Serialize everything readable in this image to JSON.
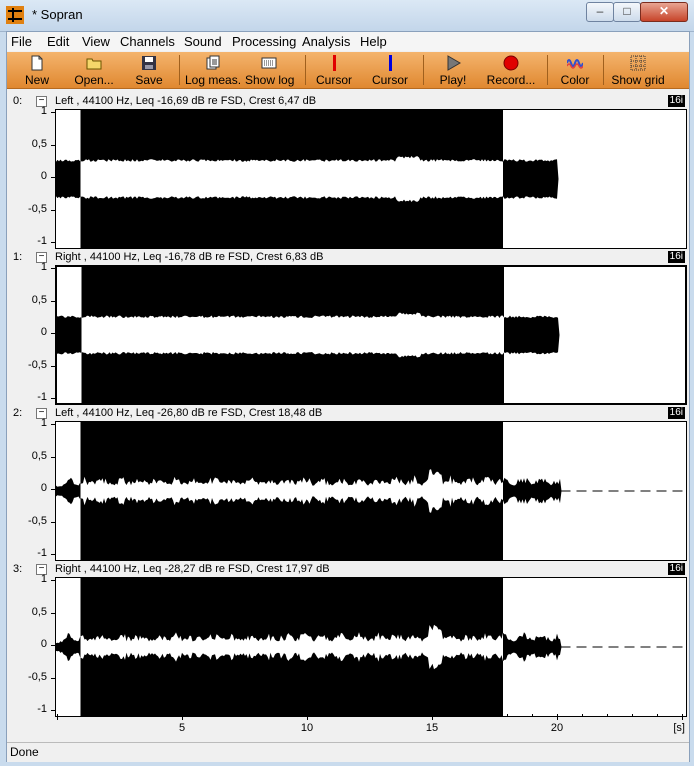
{
  "window": {
    "title": "* Sopran",
    "minimize": "–",
    "maximize": "□",
    "close": "✕"
  },
  "menu": [
    "File",
    "Edit",
    "View",
    "Channels",
    "Sound",
    "Processing",
    "Analysis",
    "Help"
  ],
  "toolbar": [
    {
      "label": "New",
      "icon": "new-file-icon"
    },
    {
      "label": "Open...",
      "icon": "open-folder-icon"
    },
    {
      "label": "Save",
      "icon": "floppy-disk-icon"
    },
    {
      "label": "Log meas.",
      "icon": "log-measurement-icon"
    },
    {
      "label": "Show log",
      "icon": "show-log-icon"
    },
    {
      "label": "Cursor",
      "icon": "red-cursor-icon",
      "color": "#e00000"
    },
    {
      "label": "Cursor",
      "icon": "blue-cursor-icon",
      "color": "#0000e0"
    },
    {
      "label": "Play!",
      "icon": "play-icon"
    },
    {
      "label": "Record...",
      "icon": "record-icon",
      "color": "#e00000"
    },
    {
      "label": "Color",
      "icon": "color-icon"
    },
    {
      "label": "Show grid",
      "icon": "grid-icon"
    }
  ],
  "channels": [
    {
      "index": "0:",
      "collapse": "−",
      "info": "Left , 44100 Hz, Leq -16,69 dB re FSD, Crest 6,47 dB",
      "badge": "16i"
    },
    {
      "index": "1:",
      "collapse": "−",
      "info": "Right , 44100 Hz, Leq -16,78 dB re FSD, Crest 6,83 dB",
      "badge": "16i"
    },
    {
      "index": "2:",
      "collapse": "−",
      "info": "Left , 44100 Hz, Leq -26,80 dB re FSD, Crest 18,48 dB",
      "badge": "16i"
    },
    {
      "index": "3:",
      "collapse": "−",
      "info": "Right , 44100 Hz, Leq -28,27 dB re FSD, Crest 17,97 dB",
      "badge": "16i"
    }
  ],
  "y_ticks": [
    "1",
    "0,5",
    "0",
    "-0,5",
    "-1"
  ],
  "x_ticks": [
    "5",
    "10",
    "15",
    "20"
  ],
  "x_unit": "[s]",
  "selection": {
    "start_s": 0.9,
    "end_s": 17.8
  },
  "status": "Done"
}
